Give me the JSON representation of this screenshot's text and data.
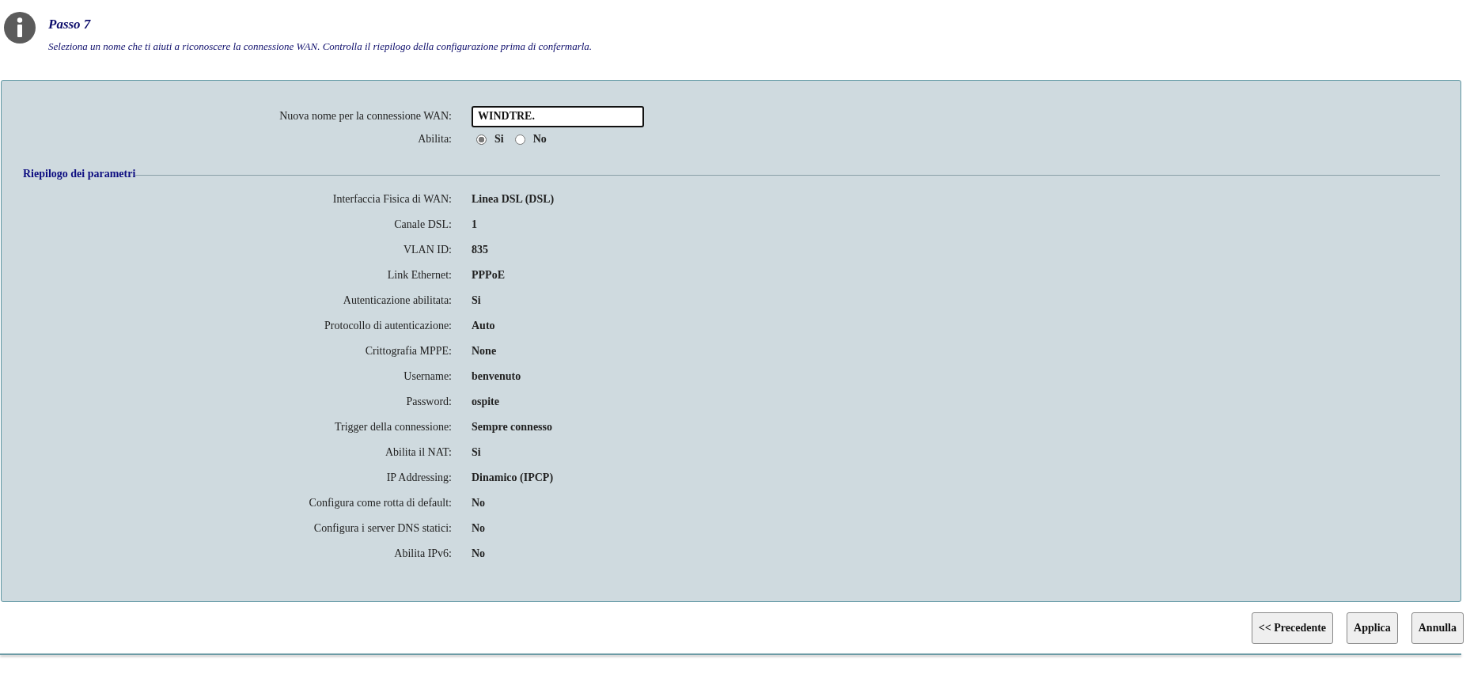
{
  "header": {
    "title": "Passo 7",
    "description": "Seleziona un nome che ti aiuti a riconoscere la connessione WAN. Controlla il riepilogo della configurazione prima di confermarla."
  },
  "form": {
    "name_label": "Nuova nome per la connessione WAN:",
    "name_value": "WINDTRE.",
    "enable_label": "Abilita:",
    "enable_options": [
      {
        "label": "Si",
        "selected": true
      },
      {
        "label": "No",
        "selected": false
      }
    ]
  },
  "summary": {
    "title": "Riepilogo dei parametri",
    "rows": [
      {
        "label": "Interfaccia Fisica di WAN:",
        "value": "Linea DSL (DSL)"
      },
      {
        "label": "Canale DSL:",
        "value": "1"
      },
      {
        "label": "VLAN ID:",
        "value": "835"
      },
      {
        "label": "Link Ethernet:",
        "value": "PPPoE"
      },
      {
        "label": "Autenticazione abilitata:",
        "value": "Si"
      },
      {
        "label": "Protocollo di autenticazione:",
        "value": "Auto"
      },
      {
        "label": "Crittografia MPPE:",
        "value": "None"
      },
      {
        "label": "Username:",
        "value": "benvenuto"
      },
      {
        "label": "Password:",
        "value": "ospite"
      },
      {
        "label": "Trigger della connessione:",
        "value": "Sempre connesso"
      },
      {
        "label": "Abilita il NAT:",
        "value": "Si"
      },
      {
        "label": "IP Addressing:",
        "value": "Dinamico (IPCP)"
      },
      {
        "label": "Configura come rotta di default:",
        "value": "No"
      },
      {
        "label": "Configura i server DNS statici:",
        "value": "No"
      },
      {
        "label": "Abilita IPv6:",
        "value": "No"
      }
    ]
  },
  "buttons": [
    "<< Precedente",
    "Applica",
    "Annulla"
  ]
}
